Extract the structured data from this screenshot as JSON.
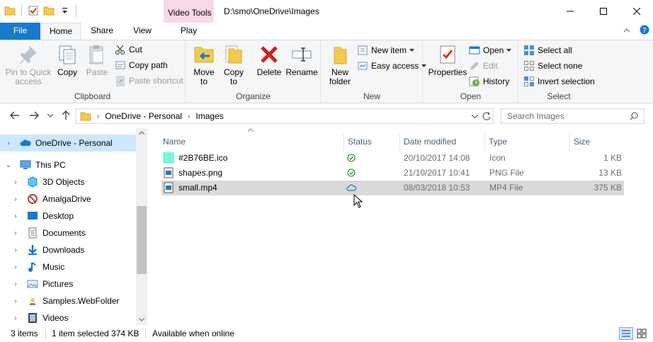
{
  "window": {
    "path": "D:\\smo\\OneDrive\\Images",
    "context_tab": "Video Tools"
  },
  "tabs": {
    "file": "File",
    "home": "Home",
    "share": "Share",
    "view": "View",
    "play": "Play"
  },
  "ribbon": {
    "clipboard": {
      "label": "Clipboard",
      "pin": "Pin to Quick\naccess",
      "copy": "Copy",
      "paste": "Paste",
      "cut": "Cut",
      "copy_path": "Copy path",
      "paste_shortcut": "Paste shortcut"
    },
    "organize": {
      "label": "Organize",
      "move_to": "Move\nto",
      "copy_to": "Copy\nto",
      "delete": "Delete",
      "rename": "Rename"
    },
    "new": {
      "label": "New",
      "new_folder": "New\nfolder",
      "new_item": "New item",
      "easy_access": "Easy access"
    },
    "open": {
      "label": "Open",
      "properties": "Properties",
      "open": "Open",
      "edit": "Edit",
      "history": "History"
    },
    "select": {
      "label": "Select",
      "select_all": "Select all",
      "select_none": "Select none",
      "invert": "Invert selection"
    }
  },
  "address": {
    "crumbs": [
      "OneDrive - Personal",
      "Images"
    ],
    "search_placeholder": "Search Images"
  },
  "nav": {
    "items": [
      {
        "label": "OneDrive - Personal",
        "icon": "onedrive-cloud-icon"
      },
      {
        "label": "This PC",
        "icon": "computer-icon"
      },
      {
        "label": "3D Objects",
        "icon": "3d-objects-icon"
      },
      {
        "label": "AmalgaDrive",
        "icon": "amalgadrive-icon"
      },
      {
        "label": "Desktop",
        "icon": "desktop-icon"
      },
      {
        "label": "Documents",
        "icon": "documents-icon"
      },
      {
        "label": "Downloads",
        "icon": "downloads-icon"
      },
      {
        "label": "Music",
        "icon": "music-icon"
      },
      {
        "label": "Pictures",
        "icon": "pictures-icon"
      },
      {
        "label": "Samples.WebFolder",
        "icon": "webfolder-icon"
      },
      {
        "label": "Videos",
        "icon": "videos-icon"
      }
    ]
  },
  "columns": {
    "name": "Name",
    "status": "Status",
    "date": "Date modified",
    "type": "Type",
    "size": "Size"
  },
  "files": [
    {
      "name": "#2B76BE.ico",
      "status": "synced",
      "date": "20/10/2017 14:08",
      "type": "Icon",
      "size": "1 KB"
    },
    {
      "name": "shapes.png",
      "status": "synced",
      "date": "21/10/2017 10:41",
      "type": "PNG File",
      "size": "13 KB"
    },
    {
      "name": "small.mp4",
      "status": "cloud",
      "date": "08/03/2018 10:53",
      "type": "MP4 File",
      "size": "375 KB"
    }
  ],
  "colors": {
    "ico_swatch": "#7ff5d7",
    "accent": "#1979ca"
  },
  "status": {
    "items": "3 items",
    "selected": "1 item selected  374 KB",
    "availability": "Available when online"
  }
}
